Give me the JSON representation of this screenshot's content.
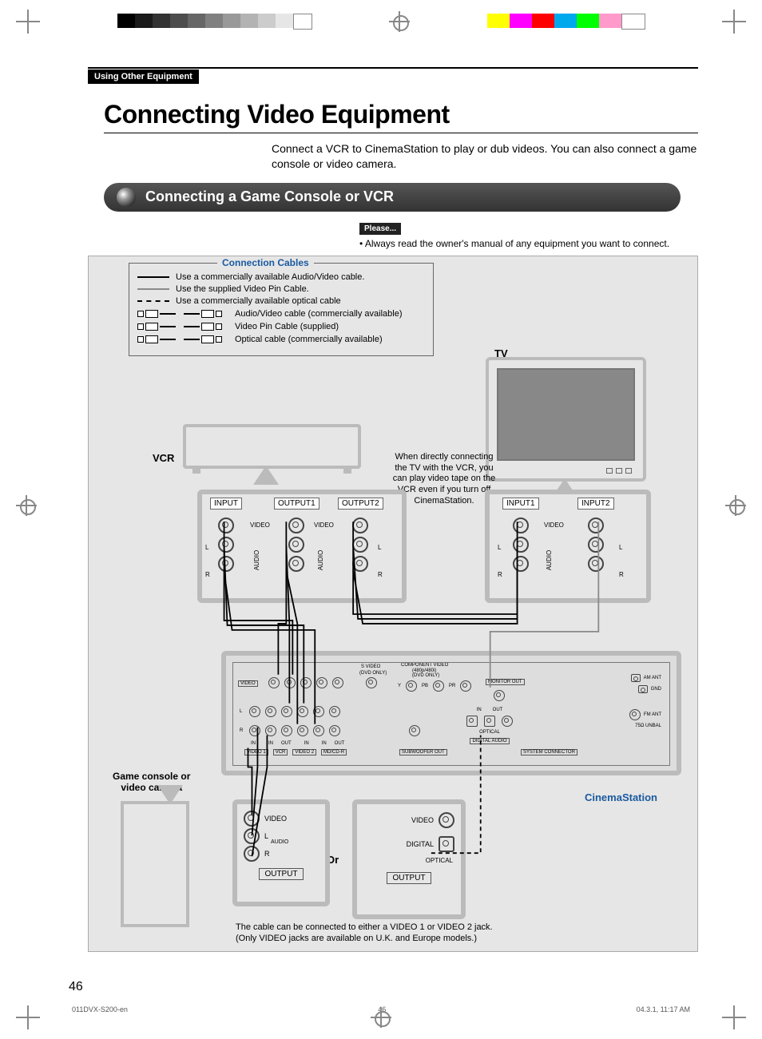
{
  "section_tab": "Using Other Equipment",
  "title": "Connecting Video Equipment",
  "intro": "Connect a VCR to CinemaStation to play or dub videos. You can also connect a game console or video camera.",
  "subhead": "Connecting a Game Console or VCR",
  "please_label": "Please...",
  "please_text": "• Always read the owner's manual of any equipment you want to connect.",
  "legend": {
    "title": "Connection Cables",
    "lines": {
      "l1": "Use a commercially available Audio/Video cable.",
      "l2": "Use the supplied Video Pin Cable.",
      "l3": "Use a commercially available optical cable"
    },
    "cables": {
      "av": "Audio/Video cable (commercially available)",
      "pin": "Video Pin Cable (supplied)",
      "opt": "Optical cable (commercially available)"
    }
  },
  "labels": {
    "vcr": "VCR",
    "tv": "TV",
    "game": "Game console or\nvideo camera",
    "cs": "CinemaStation",
    "or": "Or"
  },
  "note_center": "When directly connecting the TV with the VCR, you can play video tape on the VCR even if you turn off CinemaStation.",
  "vcr_panel": {
    "input": "INPUT",
    "output1": "OUTPUT1",
    "output2": "OUTPUT2",
    "video": "VIDEO",
    "audio": "AUDIO",
    "l": "L",
    "r": "R"
  },
  "tv_panel": {
    "input1": "INPUT1",
    "input2": "INPUT2",
    "video": "VIDEO",
    "audio": "AUDIO",
    "l": "L",
    "r": "R"
  },
  "cs_panel": {
    "video": "VIDEO",
    "svideo": "S VIDEO",
    "svideo_sub": "(DVD ONLY)",
    "component": "COMPONENT VIDEO",
    "component_sub": "(480p/480i)",
    "component_sub2": "(DVD ONLY)",
    "y": "Y",
    "pb": "PB",
    "pr": "PR",
    "monitor_out": "MONITOR OUT",
    "l": "L",
    "r": "R",
    "in": "IN",
    "out": "OUT",
    "video1": "VIDEO 1",
    "vcr": "VCR",
    "video2": "VIDEO 2",
    "mdcdr": "MD/CD-R",
    "subout": "SUBWOOFER OUT",
    "optical": "OPTICAL",
    "digaudio": "DIGITAL AUDIO",
    "sysconn": "SYSTEM CONNECTOR",
    "am_ant": "AM ANT",
    "gnd": "GND",
    "fm_ant": "FM ANT",
    "unbal": "75Ω UNBAL"
  },
  "game_out": {
    "video": "VIDEO",
    "audio": "AUDIO",
    "l": "L",
    "r": "R",
    "output": "OUTPUT"
  },
  "game_out2": {
    "video": "VIDEO",
    "digital": "DIGITAL",
    "optical": "OPTICAL",
    "output": "OUTPUT"
  },
  "footnote": {
    "l1": "The cable can be connected to either a VIDEO 1 or VIDEO 2 jack.",
    "l2": "(Only VIDEO jacks are available on U.K. and Europe models.)"
  },
  "page_number": "46",
  "footer": {
    "file": "011DVX-S200-en",
    "page": "46",
    "timestamp": "04.3.1, 11:17 AM"
  },
  "colorbar": [
    "#ffff00",
    "#ff00ff",
    "#ff0000",
    "#00a8ec",
    "#00ff00",
    "#ff9acb",
    "#ffffff"
  ],
  "graybar": [
    "#fff",
    "#000",
    "#222",
    "#444",
    "#666",
    "#888",
    "#aaa",
    "#ccc",
    "#ddd",
    "#eee",
    "#fff"
  ]
}
